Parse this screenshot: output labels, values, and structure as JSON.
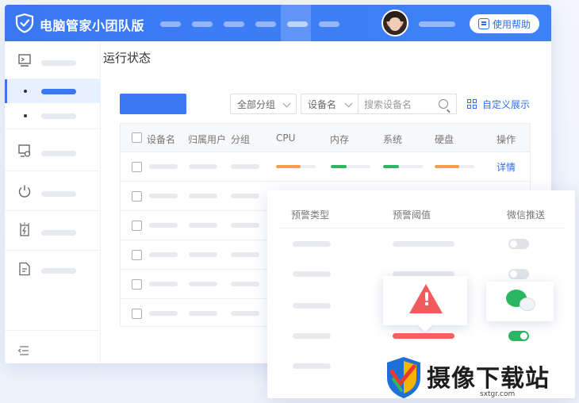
{
  "app": {
    "title": "电脑管家小团队版",
    "help_label": "使用帮助"
  },
  "page": {
    "title": "运行状态"
  },
  "filters": {
    "group_select": "全部分组",
    "field_select": "设备名",
    "search_placeholder": "搜索设备名",
    "custom_display": "自定义展示"
  },
  "table": {
    "headers": [
      "设备名",
      "归属用户",
      "分组",
      "CPU",
      "内存",
      "系统",
      "硬盘",
      "操作"
    ],
    "row_action": "详情"
  },
  "alert_panel": {
    "headers": [
      "预警类型",
      "预警阈值",
      "微信推送"
    ],
    "toggles": [
      false,
      false,
      false,
      true
    ]
  },
  "watermark": {
    "brand": "摄像下载站",
    "url": "sxtgr.com"
  },
  "colors": {
    "primary": "#3a78f2",
    "success": "#2bb662",
    "warning": "#f25b5b",
    "cpu": "#f0a04b",
    "mem": "#2bb662"
  }
}
